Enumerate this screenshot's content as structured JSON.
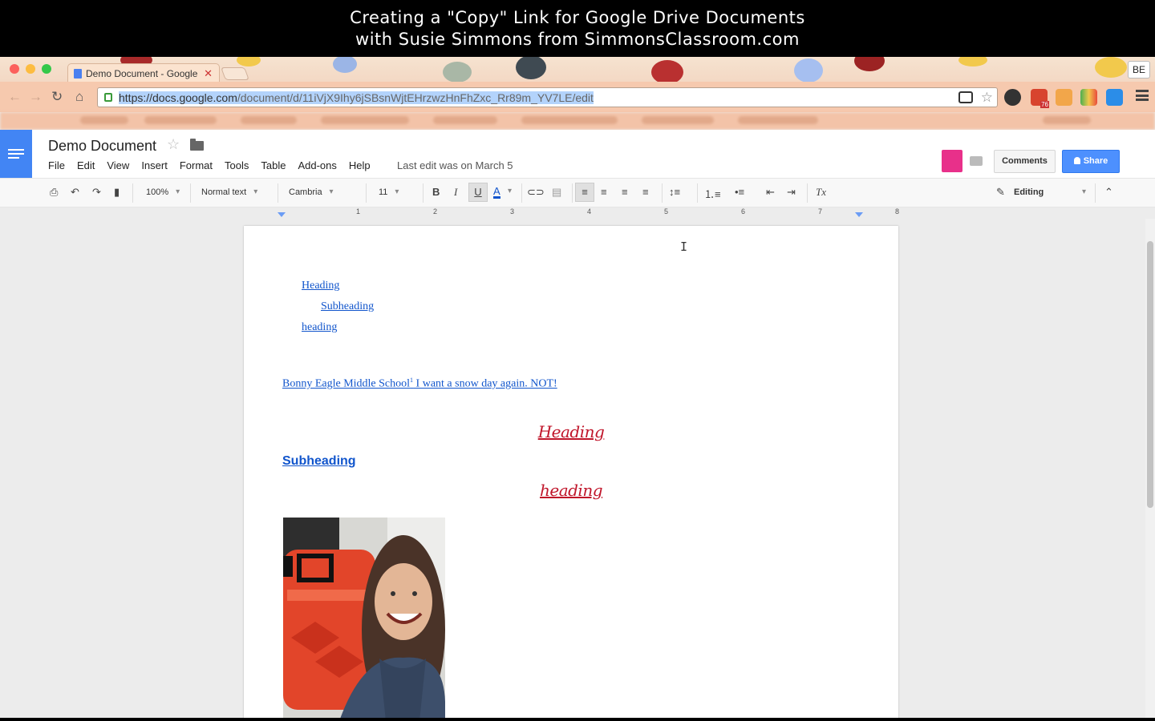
{
  "banner": {
    "line1": "Creating a \"Copy\" Link for Google Drive Documents",
    "line2": "with Susie Simmons from SimmonsClassroom.com"
  },
  "browser": {
    "tab_title": "Demo Document - Google",
    "url_host": "https://docs.google.com",
    "url_path": "/document/d/11iVjX9Ihy6jSBsnWjtEHrzwzHnFhZxc_Rr89m_YV7LE/edit",
    "profile_initials": "BE",
    "extension_badge": "76"
  },
  "docs": {
    "title": "Demo Document",
    "menu": [
      "File",
      "Edit",
      "View",
      "Insert",
      "Format",
      "Tools",
      "Table",
      "Add-ons",
      "Help"
    ],
    "last_edit": "Last edit was on March 5",
    "comments_label": "Comments",
    "share_label": "Share"
  },
  "toolbar": {
    "zoom": "100%",
    "style": "Normal text",
    "font": "Cambria",
    "size": "11",
    "bold": "B",
    "italic": "I",
    "underline": "U",
    "text_color": "A",
    "clear_format": "Tx",
    "mode": "Editing"
  },
  "ruler": [
    "1",
    "2",
    "3",
    "4",
    "5",
    "6",
    "7",
    "8"
  ],
  "document": {
    "toc": [
      "Heading",
      "Subheading",
      "heading"
    ],
    "paragraph_before_sup": "Bonny Eagle Middle School",
    "footnote_mark": "1",
    "paragraph_after_sup": " I want a snow day again. NOT!",
    "heading1": "Heading",
    "heading2": "Subheading",
    "heading3": "heading"
  },
  "colors": {
    "docs_blue": "#4285f4",
    "link_blue": "#1155cc",
    "heading_red": "#c0152a",
    "share_blue": "#4d90fe"
  }
}
